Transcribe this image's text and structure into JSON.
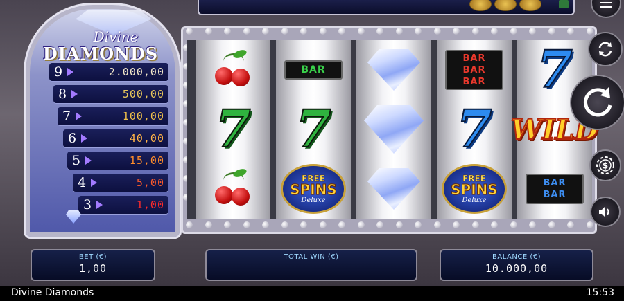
{
  "game": {
    "logo_top": "Divine",
    "logo_main": "DIAMONDS"
  },
  "paytable": [
    {
      "count": "9",
      "payout": "2.000,00",
      "color": "#f2e7c9"
    },
    {
      "count": "8",
      "payout": "500,00",
      "color": "#e9c85a"
    },
    {
      "count": "7",
      "payout": "100,00",
      "color": "#f0c04a"
    },
    {
      "count": "6",
      "payout": "40,00",
      "color": "#ffb347"
    },
    {
      "count": "5",
      "payout": "15,00",
      "color": "#ff8c2a"
    },
    {
      "count": "4",
      "payout": "5,00",
      "color": "#ff5a2a"
    },
    {
      "count": "3",
      "payout": "1,00",
      "color": "#ff2a2a"
    }
  ],
  "reels": [
    [
      "cherry",
      "seven-green",
      "cherry"
    ],
    [
      "bar",
      "seven-green",
      "free-spins"
    ],
    [
      "diamond",
      "diamond",
      "diamond"
    ],
    [
      "triple-bar",
      "seven-blue",
      "free-spins"
    ],
    [
      "seven-blue",
      "wild",
      "double-bar"
    ]
  ],
  "symbols": {
    "bar": "BAR",
    "triple_bar": [
      "BAR",
      "BAR",
      "BAR"
    ],
    "double_bar": [
      "BAR",
      "BAR"
    ],
    "seven": "7",
    "wild": "WILD",
    "free_spins": {
      "line1": "FREE",
      "line2": "SPINS",
      "line3": "Deluxe"
    }
  },
  "info": {
    "bet_label": "BET (€)",
    "bet_value": "1,00",
    "total_win_label": "TOTAL WIN (€)",
    "total_win_value": "",
    "balance_label": "BALANCE (€)",
    "balance_value": "10.000,00"
  },
  "controls": {
    "menu": "menu-icon",
    "autoplay": "autoplay-icon",
    "spin": "spin-icon",
    "bet": "coin-bet-icon",
    "sound": "sound-icon"
  },
  "status": {
    "title": "Divine Diamonds",
    "clock": "15:53"
  }
}
